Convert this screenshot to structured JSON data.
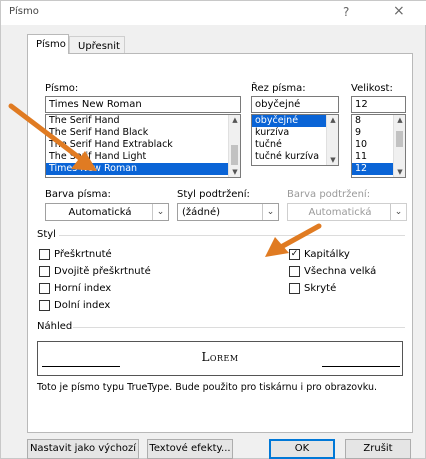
{
  "window": {
    "title": "Písmo",
    "help": "?",
    "close": "×"
  },
  "tabs": [
    {
      "label": "Písmo"
    },
    {
      "label": "Upřesnit"
    }
  ],
  "font": {
    "label": "Písmo:",
    "value": "Times New Roman",
    "items": [
      "The Serif Hand",
      "The Serif Hand Black",
      "The Serif Hand Extrablack",
      "The Serif Hand Light",
      "Times New Roman"
    ],
    "selected_index": 4
  },
  "style": {
    "label": "Řez písma:",
    "value": "obyčejné",
    "items": [
      "obyčejné",
      "kurzíva",
      "tučné",
      "tučné kurzíva"
    ],
    "selected_index": 0
  },
  "size": {
    "label": "Velikost:",
    "value": "12",
    "items": [
      "8",
      "9",
      "10",
      "11",
      "12"
    ],
    "selected_index": 4
  },
  "font_color": {
    "label": "Barva písma:",
    "value": "Automatická"
  },
  "underline_style": {
    "label": "Styl podtržení:",
    "value": "(žádné)"
  },
  "underline_color": {
    "label": "Barva podtržení:",
    "value": "Automatická"
  },
  "effects": {
    "label": "Styl",
    "left": [
      {
        "label": "Přeškrtnuté",
        "checked": false
      },
      {
        "label": "Dvojitě přeškrtnuté",
        "checked": false
      },
      {
        "label": "Horní index",
        "checked": false
      },
      {
        "label": "Dolní index",
        "checked": false
      }
    ],
    "right": [
      {
        "label": "Kapitálky",
        "checked": true
      },
      {
        "label": "Všechna velká",
        "checked": false
      },
      {
        "label": "Skryté",
        "checked": false
      }
    ]
  },
  "preview": {
    "label": "Náhled",
    "text": "Lorem",
    "note": "Toto je písmo typu TrueType. Bude použito pro tiskárnu i pro obrazovku."
  },
  "buttons": {
    "default": "Nastavit jako výchozí",
    "effects": "Textové efekty...",
    "ok": "OK",
    "cancel": "Zrušit"
  },
  "colors": {
    "selection": "#0a64d6",
    "annotation_arrow": "#e07b22",
    "primary_border": "#0078d7"
  }
}
